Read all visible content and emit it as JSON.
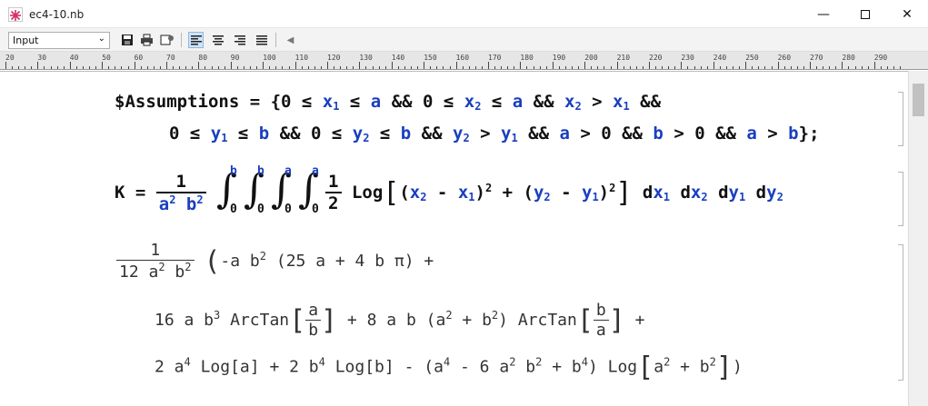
{
  "window": {
    "title": "ec4-10.nb"
  },
  "toolbar": {
    "style_value": "Input"
  },
  "ruler": {
    "labels": [
      "20",
      "30",
      "40",
      "50",
      "60",
      "70",
      "80",
      "90",
      "100",
      "110",
      "120",
      "130",
      "140",
      "150",
      "160",
      "170",
      "180",
      "190",
      "200",
      "210",
      "220",
      "230",
      "240",
      "250",
      "260",
      "270",
      "280",
      "290"
    ]
  },
  "cell1": {
    "l1": {
      "a": "$Assumptions = {0 ≤ ",
      "x": "x",
      "s1": "1",
      "b": " ≤ ",
      "av": "a",
      "c": " && 0 ≤ ",
      "x2": "x",
      "s2": "2",
      "d": " ≤ ",
      "av2": "a",
      "e": " && ",
      "x3": "x",
      "s3": "2",
      "f": " > ",
      "x4": "x",
      "s4": "1",
      "g": " &&"
    },
    "l2": {
      "a": "0 ≤ ",
      "y": "y",
      "s1": "1",
      "b": " ≤ ",
      "bv": "b",
      "c": " && 0 ≤ ",
      "y2": "y",
      "s2": "2",
      "d": " ≤ ",
      "bv2": "b",
      "e": " && ",
      "y3": "y",
      "s3": "2",
      "f": " > ",
      "y4": "y",
      "s4": "1",
      "g": " && ",
      "av": "a",
      "h": " > 0 && ",
      "bv3": "b",
      "i": " > 0 && ",
      "av2": "a",
      "j": " > ",
      "bv4": "b",
      "k": "};"
    }
  },
  "cell2": {
    "k": "K = ",
    "one": "1",
    "a": "a",
    "two": "2",
    "b": "b",
    "two2": "2",
    "int": [
      {
        "hi": "b",
        "lo": "0"
      },
      {
        "hi": "b",
        "lo": "0"
      },
      {
        "hi": "a",
        "lo": "0"
      },
      {
        "hi": "a",
        "lo": "0"
      }
    ],
    "half_num": "1",
    "half_den": "2",
    "log": "Log",
    "p1": "(",
    "x2": "x",
    "s2": "2",
    "minus": " - ",
    "x1": "x",
    "s1": "1",
    "p2": ")",
    "sq": "2",
    "plus": " + ",
    "p3": "(",
    "y2": "y",
    "t2": "2",
    "minus2": " - ",
    "y1": "y",
    "t1": "1",
    "p4": ")",
    "sq2": "2",
    "d1": "d",
    "dx1": "x",
    "ds1": "1",
    "d2": "d",
    "dx2": "x",
    "ds2": "2",
    "d3": "d",
    "dy1": "y",
    "ds3": "1",
    "d4": "d",
    "dy2": "y",
    "ds4": "2"
  },
  "cell3": {
    "one": "1",
    "den": "12 a",
    "den_e": "2",
    "den_b": " b",
    "den_e2": "2",
    "l1": {
      "a": "-a b",
      "e": "2",
      "b": " (25 a + 4 b π) +"
    },
    "l2": {
      "a": "16 a b",
      "e": "3",
      "b": " ArcTan",
      "num1": "a",
      "den1": "b",
      "c": " + 8 a b ",
      "pa": "(a",
      "e2": "2",
      "pb": " + b",
      "e3": "2",
      "pc": ")",
      "d": " ArcTan",
      "num2": "b",
      "den2": "a",
      "f": " +"
    },
    "l3": {
      "a": "2 a",
      "e": "4",
      "b": " Log[a] + 2 b",
      "e2": "4",
      "c": " Log[b] - ",
      "pa": "(a",
      "e3": "4",
      "pb": " - 6 a",
      "e4": "2",
      "pc": " b",
      "e5": "2",
      "pd": " + b",
      "e6": "4",
      "pe": ")",
      "d": " Log",
      "la": "a",
      "e7": "2",
      "lb": " + b",
      "e8": "2",
      "f": ")"
    }
  }
}
